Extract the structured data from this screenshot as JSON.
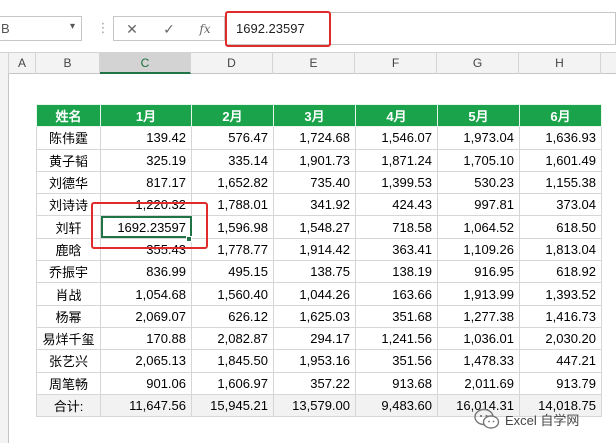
{
  "formula_bar": {
    "name_box": "B",
    "cancel_icon": "✕",
    "enter_icon": "✓",
    "fx_label": "fx",
    "value": "1692.23597"
  },
  "columns": [
    "A",
    "B",
    "C",
    "D",
    "E",
    "F",
    "G",
    "H"
  ],
  "selected_column": "C",
  "table": {
    "headers": [
      "姓名",
      "1月",
      "2月",
      "3月",
      "4月",
      "5月",
      "6月"
    ],
    "rows": [
      [
        "陈伟霆",
        "139.42",
        "576.47",
        "1,724.68",
        "1,546.07",
        "1,973.04",
        "1,636.93"
      ],
      [
        "黄子韬",
        "325.19",
        "335.14",
        "1,901.73",
        "1,871.24",
        "1,705.10",
        "1,601.49"
      ],
      [
        "刘德华",
        "817.17",
        "1,652.82",
        "735.40",
        "1,399.53",
        "530.23",
        "1,155.38"
      ],
      [
        "刘诗诗",
        "1,220.32",
        "1,788.01",
        "341.92",
        "424.43",
        "997.81",
        "373.04"
      ],
      [
        "刘轩",
        "1692.23597",
        "1,596.98",
        "1,548.27",
        "718.58",
        "1,064.52",
        "618.50"
      ],
      [
        "鹿晗",
        "355.43",
        "1,778.77",
        "1,914.42",
        "363.41",
        "1,109.26",
        "1,813.04"
      ],
      [
        "乔振宇",
        "836.99",
        "495.15",
        "138.75",
        "138.19",
        "916.95",
        "618.92"
      ],
      [
        "肖战",
        "1,054.68",
        "1,560.40",
        "1,044.26",
        "163.66",
        "1,913.99",
        "1,393.52"
      ],
      [
        "杨幂",
        "2,069.07",
        "626.12",
        "1,625.03",
        "351.68",
        "1,277.38",
        "1,416.73"
      ],
      [
        "易烊千玺",
        "170.88",
        "2,082.87",
        "294.17",
        "1,241.56",
        "1,036.01",
        "2,030.20"
      ],
      [
        "张艺兴",
        "2,065.13",
        "1,845.50",
        "1,953.16",
        "351.56",
        "1,478.33",
        "447.21"
      ],
      [
        "周笔畅",
        "901.06",
        "1,606.97",
        "357.22",
        "913.68",
        "2,011.69",
        "913.79"
      ]
    ],
    "total": [
      "合计:",
      "11,647.56",
      "15,945.21",
      "13,579.00",
      "9,483.60",
      "16,014.31",
      "14,018.75"
    ]
  },
  "watermark": "Excel 自学网",
  "colors": {
    "header_green": "#1aa34a",
    "selection_green": "#217346",
    "highlight_red": "#e02b2b"
  }
}
